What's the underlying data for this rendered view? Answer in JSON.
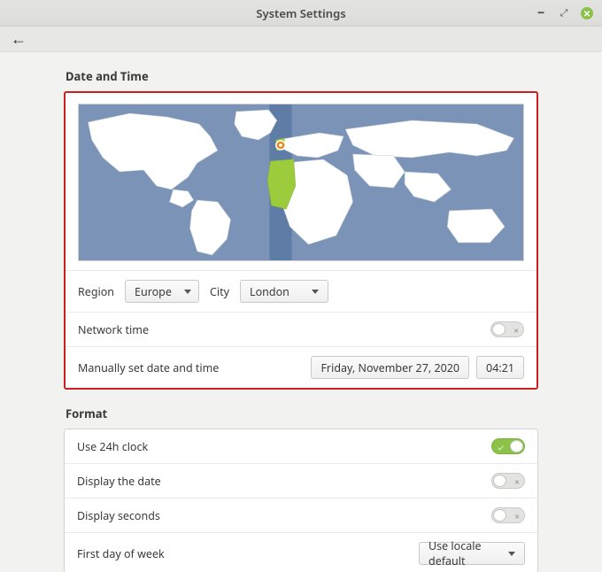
{
  "window": {
    "title": "System Settings"
  },
  "page": {
    "heading": "Date and Time",
    "region_label": "Region",
    "region_value": "Europe",
    "city_label": "City",
    "city_value": "London",
    "network_time_label": "Network time",
    "network_time_on": false,
    "manual_label": "Manually set date and time",
    "date_value": "Friday, November 27, 2020",
    "time_value": "04:21"
  },
  "format": {
    "heading": "Format",
    "use_24h_label": "Use 24h clock",
    "use_24h_on": true,
    "display_date_label": "Display the date",
    "display_date_on": false,
    "display_seconds_label": "Display seconds",
    "display_seconds_on": false,
    "first_day_label": "First day of week",
    "first_day_value": "Use locale default"
  },
  "colors": {
    "accent_green": "#8bc34a",
    "highlight_red": "#cc1f1f",
    "timezone_band": "#6a86ae"
  }
}
